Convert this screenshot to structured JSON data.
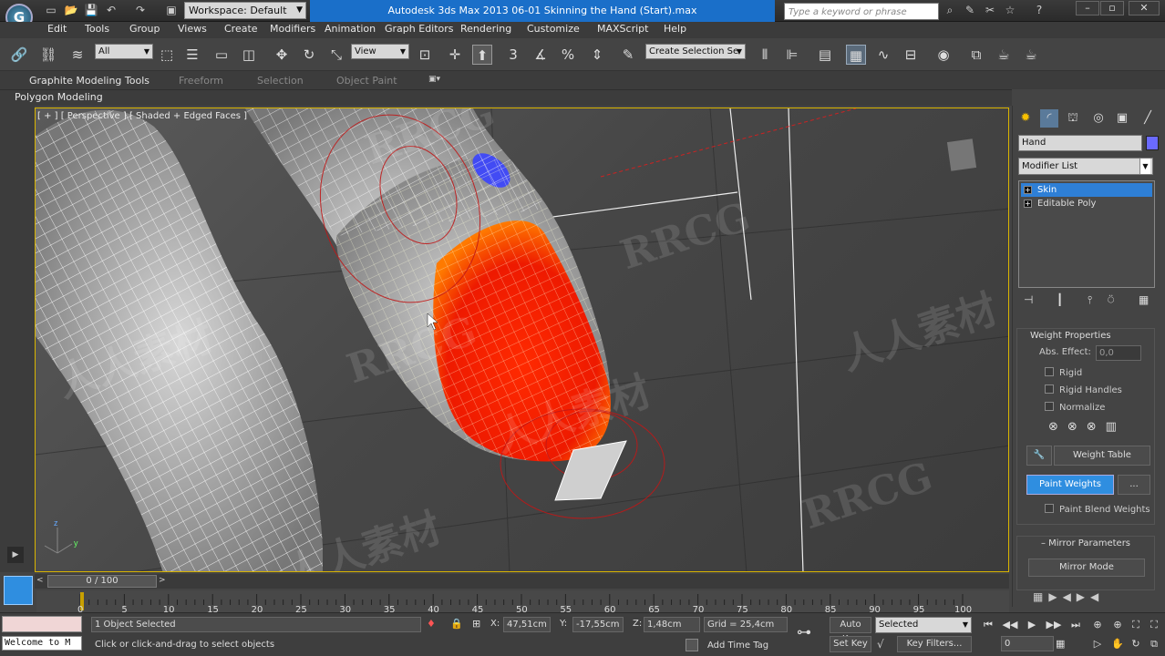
{
  "window": {
    "app_title": "Autodesk 3ds Max  2013       06-01 Skinning the Hand (Start).max",
    "workspace": "Workspace: Default",
    "search_placeholder": "Type a keyword or phrase"
  },
  "menu": [
    "Edit",
    "Tools",
    "Group",
    "Views",
    "Create",
    "Modifiers",
    "Animation",
    "Graph Editors",
    "Rendering",
    "Customize",
    "MAXScript",
    "Help"
  ],
  "toolbar": {
    "selection_filter": "All",
    "ref_coord": "View",
    "snap_label": "3",
    "named_selection": "Create Selection Se"
  },
  "ribbon": {
    "tabs": [
      "Graphite Modeling Tools",
      "Freeform",
      "Selection",
      "Object Paint"
    ],
    "panel": "Polygon Modeling"
  },
  "viewport": {
    "label": "[ + ] [ Perspective ] [ Shaded + Edged Faces ]",
    "axis_z": "z",
    "axis_y": "y"
  },
  "command_panel": {
    "object_name": "Hand",
    "object_color": "#6a6aff",
    "modifier_list": "Modifier List",
    "stack": [
      {
        "label": "Skin",
        "selected": true
      },
      {
        "label": "Editable Poly",
        "selected": false
      }
    ],
    "weight_properties": {
      "title": "Weight Properties",
      "abs_effect_label": "Abs. Effect:",
      "abs_effect_value": "0,0",
      "checkboxes": [
        "Rigid",
        "Rigid Handles",
        "Normalize"
      ],
      "weight_table": "Weight Table",
      "paint_weights": "Paint Weights",
      "paint_options": "...",
      "paint_blend": "Paint Blend Weights"
    },
    "mirror": {
      "title": "Mirror Parameters",
      "mirror_mode": "Mirror Mode"
    }
  },
  "timeline": {
    "slider": "0 / 100",
    "ticks": [
      "0",
      "5",
      "10",
      "15",
      "20",
      "25",
      "30",
      "35",
      "40",
      "45",
      "50",
      "55",
      "60",
      "65",
      "70",
      "75",
      "80",
      "85",
      "90",
      "95",
      "100"
    ]
  },
  "status": {
    "welcome": "Welcome to M",
    "selected": "1 Object Selected",
    "prompt": "Click or click-and-drag to select objects",
    "x_label": "X:",
    "x_value": "47,51cm",
    "y_label": "Y:",
    "y_value": "-17,55cm",
    "z_label": "Z:",
    "z_value": "1,48cm",
    "grid": "Grid = 25,4cm",
    "add_time_tag": "Add Time Tag",
    "auto_key": "Auto Key",
    "set_key": "Set Key",
    "key_mode": "Selected",
    "key_filters": "Key Filters...",
    "frame": "0"
  },
  "watermarks": [
    "RRCG",
    "人人素材"
  ]
}
